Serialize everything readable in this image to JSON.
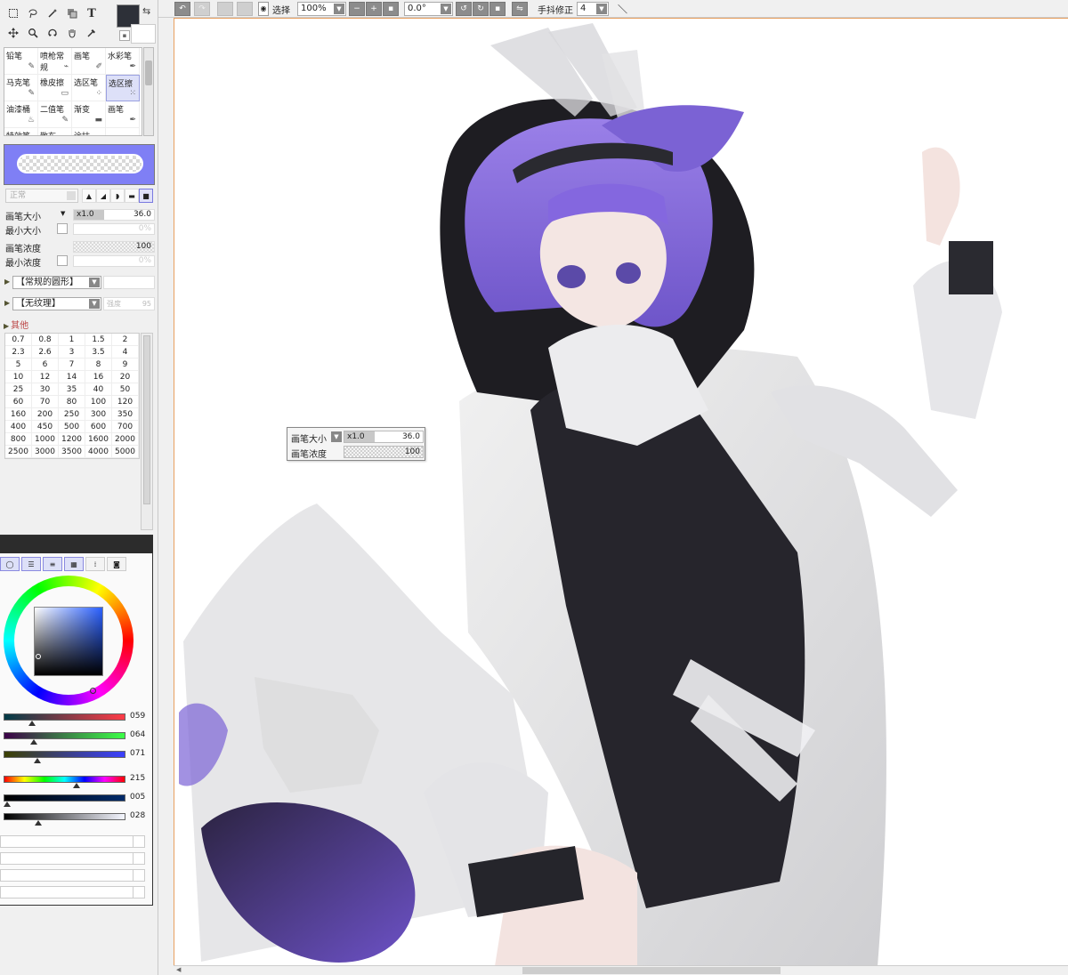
{
  "toolbar": {
    "select_label": "选择",
    "zoom": "100%",
    "rotation": "0.0°",
    "stabilizer_label": "手抖修正",
    "stabilizer_value": "4"
  },
  "colors": {
    "primary": "#2d3038",
    "canvas_border": "#e8a060",
    "selected_brush_bg": "#dde0f8",
    "brush_preview_bg": "#7f7ff5"
  },
  "tools": [
    "rect-select-icon",
    "lasso-icon",
    "magic-wand-icon",
    "layer-move-icon",
    "text-icon",
    "move-icon",
    "zoom-icon",
    "rotate-icon",
    "hand-icon",
    "eyedropper-icon"
  ],
  "tool_text": "T",
  "brushes": [
    {
      "label": "铅笔",
      "icon": "✎"
    },
    {
      "label": "喷枪常规",
      "icon": "⌁"
    },
    {
      "label": "画笔",
      "icon": "✐"
    },
    {
      "label": "水彩笔",
      "icon": "✒"
    },
    {
      "label": "马克笔",
      "icon": "✎"
    },
    {
      "label": "橡皮擦",
      "icon": "▭"
    },
    {
      "label": "选区笔",
      "icon": "⁘"
    },
    {
      "label": "选区擦",
      "icon": "⁙"
    },
    {
      "label": "油漆桶",
      "icon": "♨"
    },
    {
      "label": "二值笔",
      "icon": "✎"
    },
    {
      "label": "渐变",
      "icon": "▬"
    },
    {
      "label": "画笔",
      "icon": "✒"
    },
    {
      "label": "特效笔",
      "icon": ""
    },
    {
      "label": "散布",
      "icon": ""
    },
    {
      "label": "涂抹",
      "icon": ""
    },
    {
      "label": "",
      "icon": ""
    }
  ],
  "brush_settings": {
    "blend_mode": "正常",
    "size_label": "画笔大小",
    "size_multiplier": "x1.0",
    "size_value": "36.0",
    "min_size_label": "最小大小",
    "min_size_value": "0%",
    "density_label": "画笔浓度",
    "density_value": "100",
    "min_density_label": "最小浓度",
    "min_density_value": "0%",
    "shape_select": "【常规的圆形】",
    "texture_select": "【无纹理】",
    "texture_strength_label": "强度",
    "texture_strength_value": "95",
    "other_label": "其他"
  },
  "sizes": [
    "0.7",
    "0.8",
    "1",
    "1.5",
    "2",
    "2.3",
    "2.6",
    "3",
    "3.5",
    "4",
    "5",
    "6",
    "7",
    "8",
    "9",
    "10",
    "12",
    "14",
    "16",
    "20",
    "25",
    "30",
    "35",
    "40",
    "50",
    "60",
    "70",
    "80",
    "100",
    "120",
    "160",
    "200",
    "250",
    "300",
    "350",
    "400",
    "450",
    "500",
    "600",
    "700",
    "800",
    "1000",
    "1200",
    "1600",
    "2000",
    "2500",
    "3000",
    "3500",
    "4000",
    "5000"
  ],
  "color_panel": {
    "tabs": [
      "wheel-tab-icon",
      "rgb-slider-tab-icon",
      "hsv-slider-tab-icon",
      "mixer-tab-icon",
      "palette-tab-icon",
      "swatch-tab-icon"
    ],
    "rgb": {
      "r": "059",
      "g": "064",
      "b": "071"
    },
    "hsv": {
      "h": "215",
      "s": "005",
      "v": "028"
    }
  },
  "popup": {
    "size_label": "画笔大小",
    "size_multiplier": "x1.0",
    "size_value": "36.0",
    "density_label": "画笔浓度",
    "density_value": "100"
  }
}
